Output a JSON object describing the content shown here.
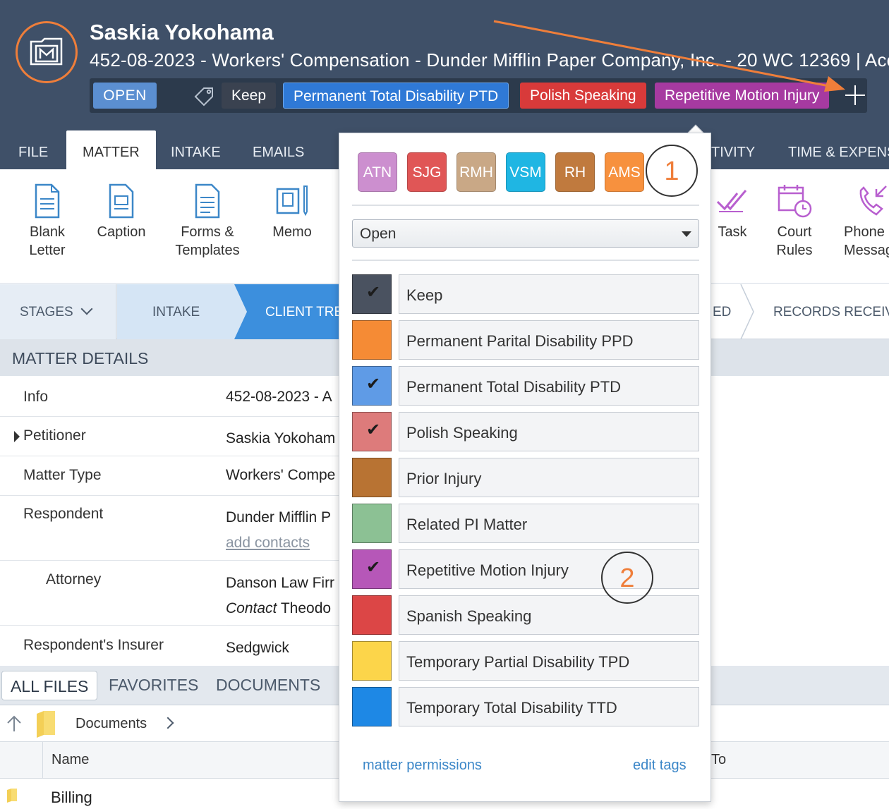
{
  "header": {
    "client_name": "Saskia Yokohama",
    "matter_title": "452-08-2023 - Workers' Compensation - Dunder Mifflin Paper Company, Inc. - 20 WC 12369 | Acc",
    "status": "OPEN",
    "tags": [
      {
        "label": "Keep",
        "color": "#3a4250"
      },
      {
        "label": "Permanent Total Disability PTD",
        "color": "#2f79d6"
      },
      {
        "label": "Polish Speaking",
        "color": "#d83a3a"
      },
      {
        "label": "Repetitive Motion Injury",
        "color": "#a63aa0"
      }
    ]
  },
  "tabs": [
    "FILE",
    "MATTER",
    "INTAKE",
    "EMAILS",
    "TIVITY",
    "TIME & EXPENS"
  ],
  "ribbon": {
    "blank_letter": "Blank\nLetter",
    "caption": "Caption",
    "forms_templates": "Forms &\nTemplates",
    "memo": "Memo",
    "task": "Task",
    "court_rules": "Court\nRules",
    "phone_message": "Phone\nMessag"
  },
  "stages": {
    "label": "STAGES",
    "intake": "INTAKE",
    "client_tre": "CLIENT TRE",
    "ed": "ED",
    "records_received": "RECORDS RECEIVE"
  },
  "matter_details": {
    "heading": "MATTER DETAILS",
    "rows": [
      {
        "label": "Info",
        "value": "452-08-2023 - A"
      },
      {
        "label": "Petitioner",
        "value": "Saskia Yokoham"
      },
      {
        "label": "Matter Type",
        "value": "Workers' Compe"
      },
      {
        "label": "Respondent",
        "value": "Dunder Mifflin P",
        "link": "add contacts"
      },
      {
        "label": "Attorney",
        "value": "Danson Law Firr",
        "contact_label": "Contact",
        "contact_value": "Theodo"
      },
      {
        "label": "Respondent's Insurer",
        "value": "Sedgwick"
      }
    ]
  },
  "files": {
    "tabs": [
      "ALL FILES",
      "FAVORITES",
      "DOCUMENTS"
    ],
    "path": "Documents",
    "col_name": "Name",
    "col_to": "To",
    "first_row": "Billing"
  },
  "popup": {
    "users": [
      {
        "initials": "ATN",
        "color": "#cc8fcf"
      },
      {
        "initials": "SJG",
        "color": "#e05656"
      },
      {
        "initials": "RMH",
        "color": "#c9a886"
      },
      {
        "initials": "VSM",
        "color": "#1fb6e3"
      },
      {
        "initials": "RH",
        "color": "#c07a3e"
      },
      {
        "initials": "AMS",
        "color": "#f7913e"
      }
    ],
    "status_value": "Open",
    "tag_options": [
      {
        "label": "Keep",
        "color": "#4a5260",
        "checked": true
      },
      {
        "label": "Permanent Parital Disability PPD",
        "color": "#f58b35",
        "checked": false
      },
      {
        "label": "Permanent Total Disability PTD",
        "color": "#5f9be6",
        "checked": true
      },
      {
        "label": "Polish Speaking",
        "color": "#dd7b7b",
        "checked": true
      },
      {
        "label": "Prior Injury",
        "color": "#b87333",
        "checked": false
      },
      {
        "label": "Related PI Matter",
        "color": "#8cc194",
        "checked": false
      },
      {
        "label": "Repetitive Motion Injury",
        "color": "#b657b8",
        "checked": true
      },
      {
        "label": "Spanish Speaking",
        "color": "#dc4646",
        "checked": false
      },
      {
        "label": "Temporary Partial Disability TPD",
        "color": "#fcd54a",
        "checked": false
      },
      {
        "label": "Temporary Total Disability TTD",
        "color": "#1e88e5",
        "checked": false
      }
    ],
    "matter_permissions": "matter permissions",
    "edit_tags": "edit tags"
  },
  "annotations": {
    "one": "1",
    "two": "2"
  },
  "colors": {
    "header_bg": "#3f5068",
    "accent": "#ef7e3a",
    "link": "#3c87c8"
  }
}
